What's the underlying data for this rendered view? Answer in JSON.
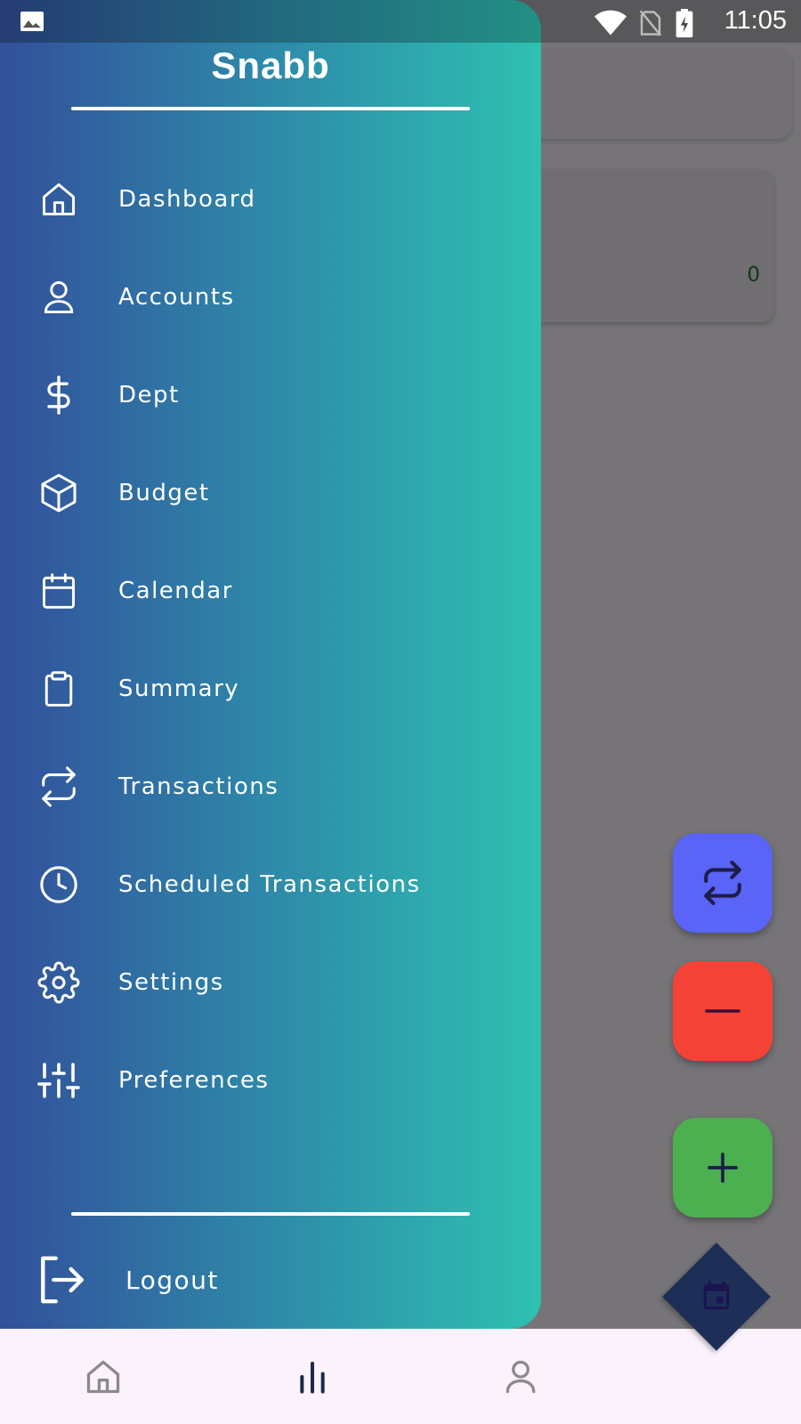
{
  "status_bar": {
    "time": "11:05"
  },
  "background": {
    "card_value": "0"
  },
  "drawer": {
    "title": "Snabb",
    "items": [
      {
        "label": "Dashboard",
        "icon": "home-icon"
      },
      {
        "label": "Accounts",
        "icon": "person-icon"
      },
      {
        "label": "Dept",
        "icon": "dollar-icon"
      },
      {
        "label": "Budget",
        "icon": "box-icon"
      },
      {
        "label": "Calendar",
        "icon": "calendar-icon"
      },
      {
        "label": "Summary",
        "icon": "clipboard-icon"
      },
      {
        "label": "Transactions",
        "icon": "repeat-icon"
      },
      {
        "label": "Scheduled Transactions",
        "icon": "clock-icon"
      },
      {
        "label": "Settings",
        "icon": "gear-icon"
      },
      {
        "label": "Preferences",
        "icon": "sliders-icon"
      }
    ],
    "logout_label": "Logout"
  },
  "fabs": {
    "transfer_color": "#5a64f6",
    "expense_color": "#f44336",
    "income_color": "#4caf50",
    "calendar_color": "#1d2f57"
  },
  "bottom_nav": [
    "home-icon",
    "bar-chart-icon",
    "person-icon"
  ]
}
